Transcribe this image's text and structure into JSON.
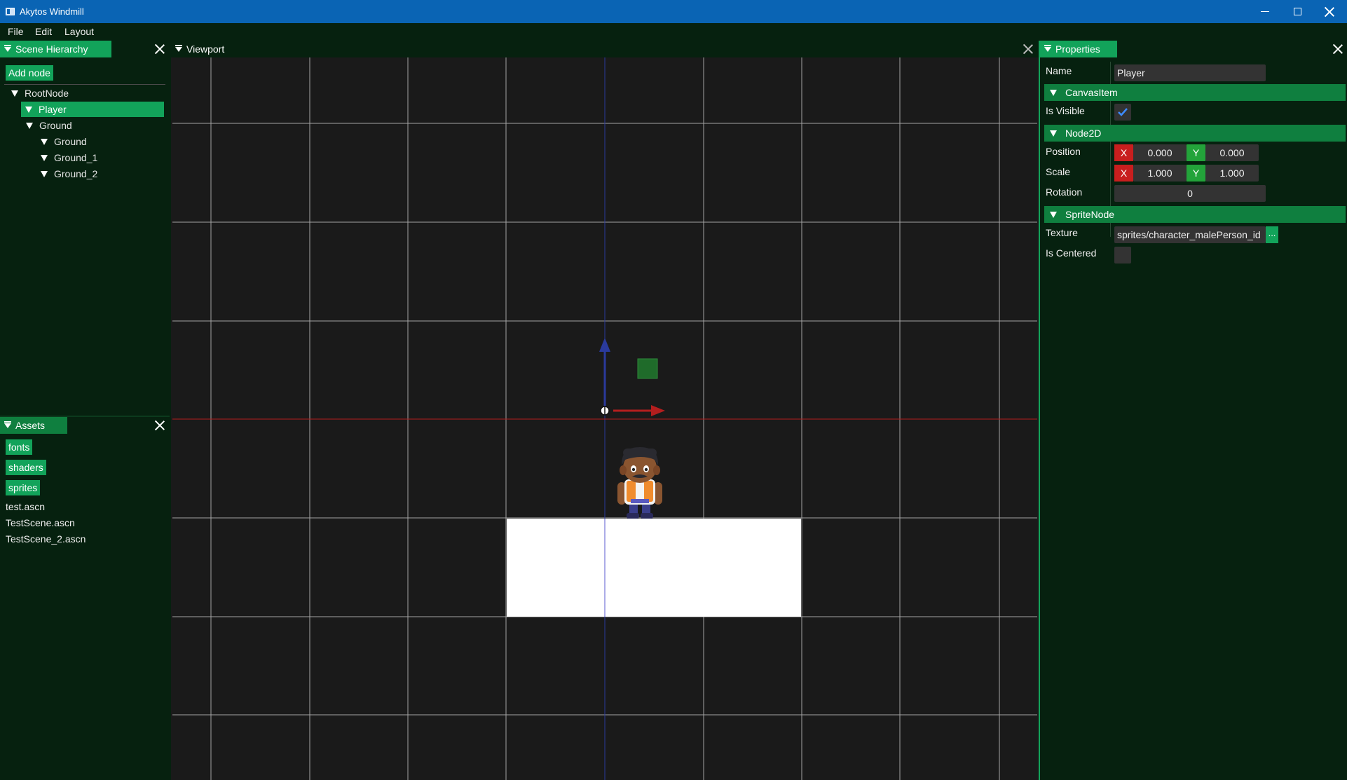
{
  "window": {
    "title": "Akytos Windmill"
  },
  "menubar": {
    "items": [
      "File",
      "Edit",
      "Layout"
    ]
  },
  "scene_hierarchy": {
    "tab_label": "Scene Hierarchy",
    "add_node_label": "Add node",
    "tree": [
      {
        "label": "RootNode",
        "depth": 0,
        "expanded": true,
        "selected": false
      },
      {
        "label": "Player",
        "depth": 1,
        "expanded": true,
        "selected": true
      },
      {
        "label": "Ground",
        "depth": 1,
        "expanded": true,
        "selected": false
      },
      {
        "label": "Ground",
        "depth": 2,
        "expanded": true,
        "selected": false
      },
      {
        "label": "Ground_1",
        "depth": 2,
        "expanded": true,
        "selected": false
      },
      {
        "label": "Ground_2",
        "depth": 2,
        "expanded": true,
        "selected": false
      }
    ]
  },
  "assets": {
    "tab_label": "Assets",
    "folders": [
      "fonts",
      "shaders",
      "sprites"
    ],
    "files": [
      "test.ascn",
      "TestScene.ascn",
      "TestScene_2.ascn"
    ]
  },
  "viewport": {
    "tab_label": "Viewport",
    "gizmo": {
      "x_axis_color": "#b41e1e",
      "y_axis_color": "#2a3a9c",
      "handle_color": "#1f6b2a"
    },
    "grid_color": "#b4b4b4",
    "ground_color": "#ffffff"
  },
  "properties": {
    "tab_label": "Properties",
    "name_label": "Name",
    "name_value": "Player",
    "sections": {
      "canvas_item": "CanvasItem",
      "node2d": "Node2D",
      "sprite_node": "SpriteNode"
    },
    "is_visible_label": "Is Visible",
    "is_visible_checked": true,
    "position_label": "Position",
    "position": {
      "x_label": "X",
      "x": "0.000",
      "y_label": "Y",
      "y": "0.000"
    },
    "scale_label": "Scale",
    "scale": {
      "x_label": "X",
      "x": "1.000",
      "y_label": "Y",
      "y": "1.000"
    },
    "rotation_label": "Rotation",
    "rotation_value": "0",
    "texture_label": "Texture",
    "texture_value": "sprites/character_malePerson_id",
    "texture_browse_label": "...",
    "is_centered_label": "Is Centered",
    "is_centered_checked": false
  },
  "colors": {
    "accent": "#12a35a",
    "panel_bg": "#06210f",
    "viewport_bg": "#1a1a1a",
    "titlebar": "#0a64b4"
  }
}
